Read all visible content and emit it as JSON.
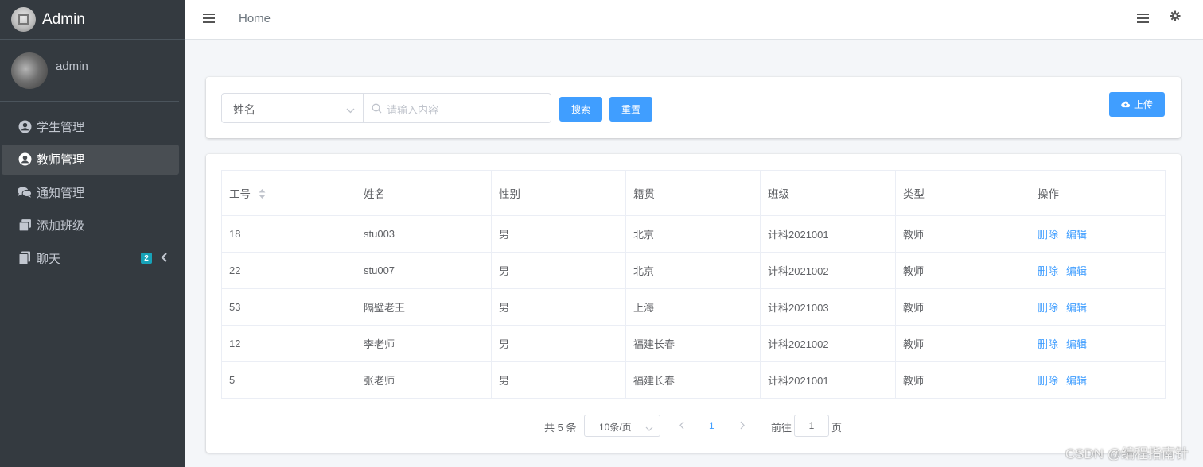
{
  "brand": {
    "title": "Admin"
  },
  "user": {
    "name": "admin"
  },
  "sidebar": {
    "items": [
      {
        "label": "学生管理",
        "icon": "user-circle-icon"
      },
      {
        "label": "教师管理",
        "icon": "user-circle-icon",
        "active": true
      },
      {
        "label": "通知管理",
        "icon": "comments-icon"
      },
      {
        "label": "添加班级",
        "icon": "copy-icon"
      },
      {
        "label": "聊天",
        "icon": "file-icon",
        "badge": "2"
      }
    ]
  },
  "header": {
    "home": "Home"
  },
  "search": {
    "field_select": "姓名",
    "placeholder": "请输入内容",
    "search_label": "搜索",
    "reset_label": "重置",
    "upload_label": "上传"
  },
  "table": {
    "headers": [
      "工号",
      "姓名",
      "性别",
      "籍贯",
      "班级",
      "类型",
      "操作"
    ],
    "rows": [
      {
        "id": "18",
        "name": "stu003",
        "gender": "男",
        "origin": "北京",
        "class": "计科2021001",
        "type": "教师"
      },
      {
        "id": "22",
        "name": "stu007",
        "gender": "男",
        "origin": "北京",
        "class": "计科2021002",
        "type": "教师"
      },
      {
        "id": "53",
        "name": "隔壁老王",
        "gender": "男",
        "origin": "上海",
        "class": "计科2021003",
        "type": "教师"
      },
      {
        "id": "12",
        "name": "李老师",
        "gender": "男",
        "origin": "福建长春",
        "class": "计科2021002",
        "type": "教师"
      },
      {
        "id": "5",
        "name": "张老师",
        "gender": "男",
        "origin": "福建长春",
        "class": "计科2021001",
        "type": "教师"
      }
    ],
    "delete_label": "删除",
    "edit_label": "编辑"
  },
  "pagination": {
    "total": "共 5 条",
    "page_size": "10条/页",
    "current_page": "1",
    "goto_label": "前往",
    "goto_value": "1",
    "page_unit": "页"
  },
  "watermark": "CSDN @编程指南针",
  "colors": {
    "sidebar_bg": "#343a40",
    "primary": "#409eff",
    "badge": "#17a2b8"
  }
}
